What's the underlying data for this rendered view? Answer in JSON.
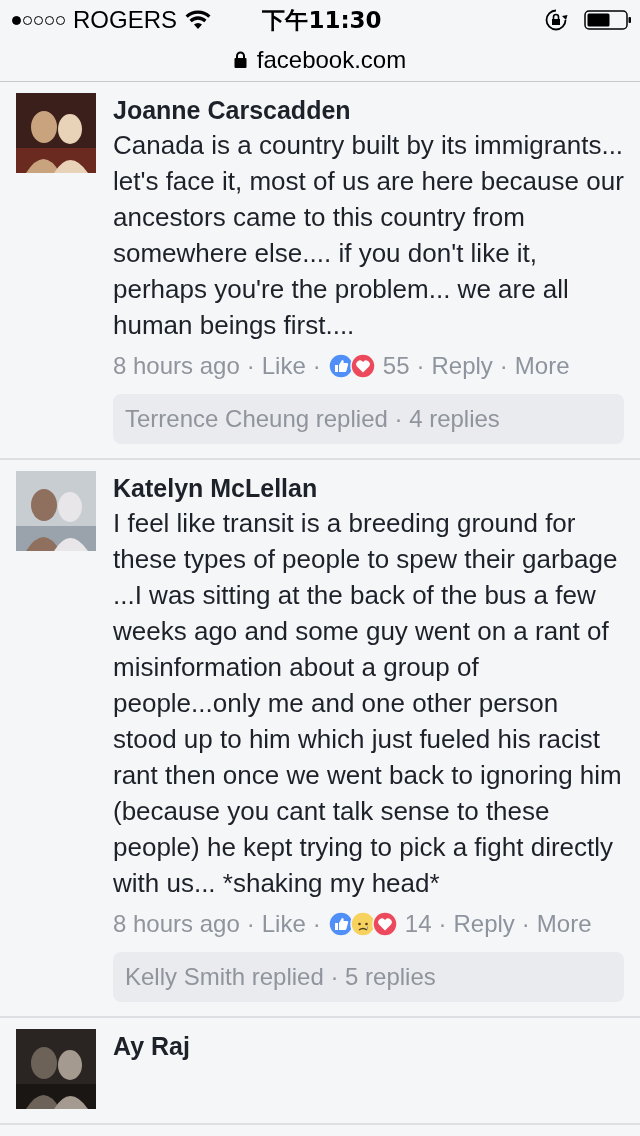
{
  "status_bar": {
    "carrier": "ROGERS",
    "time": "下午11:30"
  },
  "address_bar": {
    "url": "facebook.com"
  },
  "comments": [
    {
      "author": "Joanne Carscadden",
      "text": "Canada is a country built by its immigrants... let's face it, most of us are here because our ancestors came to this country from somewhere else.... if you don't like it, perhaps you're the problem... we are all human beings first....",
      "time": "8 hours ago",
      "separator": "·",
      "like": "Like",
      "reactions": [
        {
          "kind": "like"
        },
        {
          "kind": "love"
        }
      ],
      "reaction_count": "55",
      "reply": "Reply",
      "more": "More",
      "replies_summary": "Terrence Cheung replied · 4 replies"
    },
    {
      "author": "Katelyn McLellan",
      "text": "I feel like transit is a breeding ground for these types of people to spew their garbage ...I was sitting at the back of the bus a few weeks ago and some guy went on a rant of misinformation about a group of people...only me and one other person stood up to him which just fueled his racist rant then once we went back to ignoring him (because you cant talk sense to these people) he kept trying to pick a fight directly with us... *shaking my head*",
      "time": "8 hours ago",
      "separator": "·",
      "like": "Like",
      "reactions": [
        {
          "kind": "like"
        },
        {
          "kind": "sad"
        },
        {
          "kind": "love"
        }
      ],
      "reaction_count": "14",
      "reply": "Reply",
      "more": "More",
      "replies_summary": "Kelly Smith replied · 5 replies"
    },
    {
      "author": "Ay Raj"
    }
  ]
}
